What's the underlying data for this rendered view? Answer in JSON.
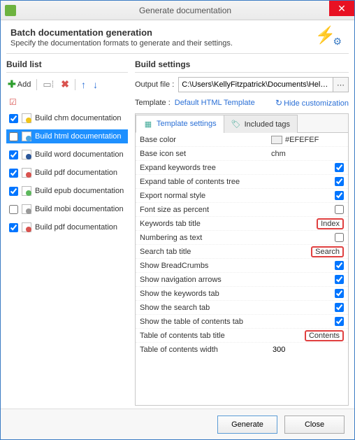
{
  "window": {
    "title": "Generate documentation"
  },
  "header": {
    "title": "Batch documentation generation",
    "subtitle": "Specify the documentation formats to generate and their settings."
  },
  "left": {
    "section": "Build list",
    "add": "Add",
    "items": [
      {
        "label": "Build chm documentation",
        "checked": true,
        "type": "chm",
        "selected": false
      },
      {
        "label": "Build html documentation",
        "checked": false,
        "type": "html",
        "selected": true
      },
      {
        "label": "Build word documentation",
        "checked": true,
        "type": "word",
        "selected": false
      },
      {
        "label": "Build pdf documentation",
        "checked": true,
        "type": "pdf",
        "selected": false
      },
      {
        "label": "Build epub documentation",
        "checked": true,
        "type": "epub",
        "selected": false
      },
      {
        "label": "Build mobi documentation",
        "checked": false,
        "type": "mobi",
        "selected": false
      },
      {
        "label": "Build pdf documentation",
        "checked": true,
        "type": "pdf",
        "selected": false
      }
    ]
  },
  "right": {
    "section": "Build settings",
    "output_label": "Output file :",
    "output_value": "C:\\Users\\KellyFitzpatrick\\Documents\\HelpNDo",
    "template_label": "Template :",
    "template_value": "Default HTML Template",
    "hide_customization": "Hide customization",
    "tabs": {
      "settings": "Template settings",
      "included": "Included tags"
    },
    "props": [
      {
        "name": "Base color",
        "kind": "color",
        "value": "#EFEFEF"
      },
      {
        "name": "Base icon set",
        "kind": "text",
        "value": "chm"
      },
      {
        "name": "Expand keywords tree",
        "kind": "check",
        "value": true
      },
      {
        "name": "Expand table of contents tree",
        "kind": "check",
        "value": true
      },
      {
        "name": "Export normal style",
        "kind": "check",
        "value": true
      },
      {
        "name": "Font size as percent",
        "kind": "check",
        "value": false
      },
      {
        "name": "Keywords tab title",
        "kind": "hl",
        "value": "Index"
      },
      {
        "name": "Numbering as text",
        "kind": "check",
        "value": false
      },
      {
        "name": "Search tab title",
        "kind": "hl",
        "value": "Search"
      },
      {
        "name": "Show BreadCrumbs",
        "kind": "check",
        "value": true
      },
      {
        "name": "Show navigation arrows",
        "kind": "check",
        "value": true
      },
      {
        "name": "Show the keywords tab",
        "kind": "check",
        "value": true
      },
      {
        "name": "Show the search tab",
        "kind": "check",
        "value": true
      },
      {
        "name": "Show the table of contents tab",
        "kind": "check",
        "value": true
      },
      {
        "name": "Table of contents tab title",
        "kind": "hl",
        "value": "Contents"
      },
      {
        "name": "Table of contents width",
        "kind": "num",
        "value": "300"
      }
    ]
  },
  "footer": {
    "generate": "Generate",
    "close": "Close"
  }
}
